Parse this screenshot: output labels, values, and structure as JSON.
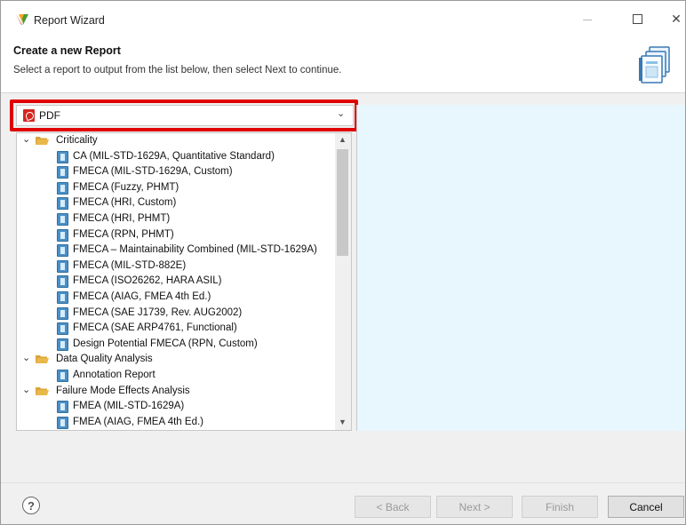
{
  "window": {
    "title": "Report Wizard"
  },
  "header": {
    "title": "Create a new Report",
    "description": "Select a report to output from the list below, then select Next to continue."
  },
  "format_select": {
    "value": "PDF"
  },
  "tree": {
    "rows": [
      {
        "type": "folder",
        "label": "Criticality"
      },
      {
        "type": "item",
        "label": "CA (MIL-STD-1629A, Quantitative Standard)"
      },
      {
        "type": "item",
        "label": "FMECA (MIL-STD-1629A, Custom)"
      },
      {
        "type": "item",
        "label": "FMECA (Fuzzy, PHMT)"
      },
      {
        "type": "item",
        "label": "FMECA (HRI, Custom)"
      },
      {
        "type": "item",
        "label": "FMECA (HRI, PHMT)"
      },
      {
        "type": "item",
        "label": "FMECA (RPN, PHMT)"
      },
      {
        "type": "item",
        "label": "FMECA – Maintainability Combined (MIL-STD-1629A)"
      },
      {
        "type": "item",
        "label": "FMECA (MIL-STD-882E)"
      },
      {
        "type": "item",
        "label": "FMECA (ISO26262, HARA ASIL)"
      },
      {
        "type": "item",
        "label": "FMECA (AIAG, FMEA 4th Ed.)"
      },
      {
        "type": "item",
        "label": "FMECA (SAE J1739, Rev. AUG2002)"
      },
      {
        "type": "item",
        "label": "FMECA (SAE ARP4761, Functional)"
      },
      {
        "type": "item",
        "label": "Design Potential FMECA (RPN, Custom)"
      },
      {
        "type": "folder",
        "label": "Data Quality Analysis"
      },
      {
        "type": "item",
        "label": "Annotation Report"
      },
      {
        "type": "folder",
        "label": "Failure Mode Effects Analysis"
      },
      {
        "type": "item",
        "label": "FMEA (MIL-STD-1629A)"
      },
      {
        "type": "item",
        "label": "FMEA (AIAG, FMEA 4th Ed.)"
      }
    ]
  },
  "buttons": {
    "help": "?",
    "back": "< Back",
    "next": "Next >",
    "finish": "Finish",
    "cancel": "Cancel"
  },
  "colors": {
    "highlight": "#e00000",
    "preview_bg": "#e8f6fd",
    "folder": "#e8b84a"
  }
}
